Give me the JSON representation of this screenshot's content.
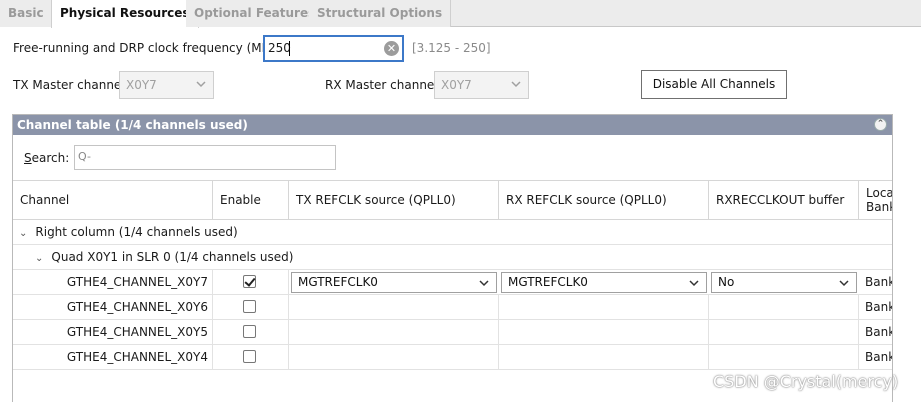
{
  "tabs": [
    "Basic",
    "Physical Resources",
    "Optional Features",
    "Structural Options"
  ],
  "clock": {
    "label": "Free-running and DRP clock frequency (MHz)",
    "value": "250",
    "range": "[3.125 - 250]"
  },
  "tx_master": {
    "label": "TX Master channel",
    "value": "X0Y7"
  },
  "rx_master": {
    "label": "RX Master channel",
    "value": "X0Y7"
  },
  "disable_all_label": "Disable All Channels",
  "channel_table": {
    "title": "Channel table (1/4 channels used)",
    "search_label_prefix": "S",
    "search_label_rest": "earch:",
    "search_placeholder": "Q-",
    "columns": [
      "Channel",
      "Enable",
      "TX REFCLK source (QPLL0)",
      "RX REFCLK source (QPLL0)",
      "RXRECCLKOUT buffer",
      "Loca",
      "Bank"
    ],
    "group": "Right column (1/4 channels used)",
    "subgroup": "Quad X0Y1 in SLR 0 (1/4 channels used)",
    "rows": [
      {
        "channel": "GTHE4_CHANNEL_X0Y7",
        "enabled": true,
        "tx_refclk": "MGTREFCLK0",
        "rx_refclk": "MGTREFCLK0",
        "rxrecclkout": "No",
        "bank": "Bank"
      },
      {
        "channel": "GTHE4_CHANNEL_X0Y6",
        "enabled": false,
        "tx_refclk": "",
        "rx_refclk": "",
        "rxrecclkout": "",
        "bank": "Bank"
      },
      {
        "channel": "GTHE4_CHANNEL_X0Y5",
        "enabled": false,
        "tx_refclk": "",
        "rx_refclk": "",
        "rxrecclkout": "",
        "bank": "Bank"
      },
      {
        "channel": "GTHE4_CHANNEL_X0Y4",
        "enabled": false,
        "tx_refclk": "",
        "rx_refclk": "",
        "rxrecclkout": "",
        "bank": "Bank"
      }
    ]
  },
  "watermark": "CSDN @Crystal(mercy)",
  "colors": {
    "panel_header": "#8b94a9",
    "focus_border": "#3c78c8"
  }
}
